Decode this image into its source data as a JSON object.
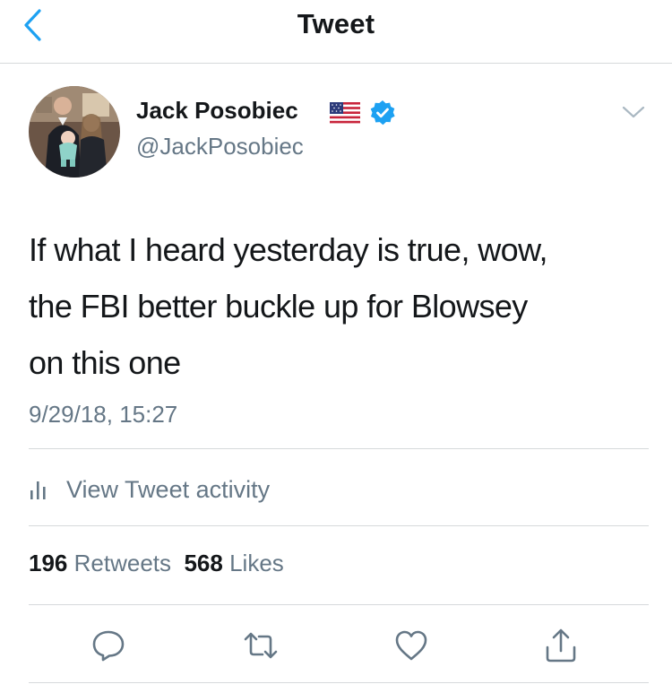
{
  "header": {
    "title": "Tweet"
  },
  "author": {
    "name": "Jack Posobiec",
    "handle": "@JackPosobiec",
    "flag_icon": "us-flag-icon",
    "verified_icon": "verified-badge-icon"
  },
  "tweet": {
    "text_lines": [
      "If what I heard yesterday is true, wow,",
      "the FBI better buckle up for Blowsey",
      "on this one"
    ],
    "timestamp": "9/29/18, 15:27"
  },
  "activity": {
    "label": "View Tweet activity",
    "icon": "bar-chart-icon"
  },
  "stats": {
    "retweets_count": "196",
    "retweets_label": "Retweets",
    "likes_count": "568",
    "likes_label": "Likes"
  },
  "actions": [
    "reply-icon",
    "retweet-icon",
    "like-icon",
    "share-icon"
  ],
  "colors": {
    "accent": "#1da1f2",
    "text": "#14171a",
    "secondary": "#657786",
    "icon": "#657786",
    "divider": "#d6d9db"
  }
}
